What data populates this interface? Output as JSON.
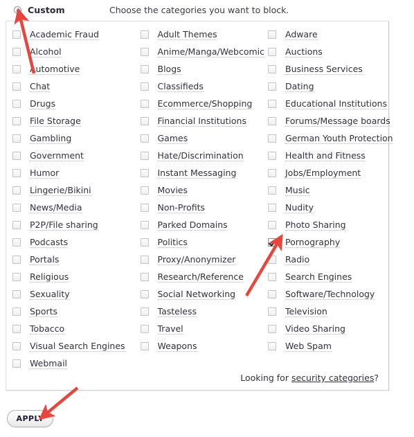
{
  "header": {
    "mode_label": "Custom",
    "instruction": "Choose the categories you want to block.",
    "radio_selected": true
  },
  "colors": {
    "text": "#31313c",
    "border": "#dedede",
    "arrow": "#e8453c",
    "checkbox_border": "#c3c3c3"
  },
  "categories": {
    "column_1": [
      {
        "label": "Academic Fraud",
        "checked": false
      },
      {
        "label": "Alcohol",
        "checked": false
      },
      {
        "label": "Automotive",
        "checked": false
      },
      {
        "label": "Chat",
        "checked": false
      },
      {
        "label": "Drugs",
        "checked": false
      },
      {
        "label": "File Storage",
        "checked": false
      },
      {
        "label": "Gambling",
        "checked": false
      },
      {
        "label": "Government",
        "checked": false
      },
      {
        "label": "Humor",
        "checked": false
      },
      {
        "label": "Lingerie/Bikini",
        "checked": false
      },
      {
        "label": "News/Media",
        "checked": false
      },
      {
        "label": "P2P/File sharing",
        "checked": false
      },
      {
        "label": "Podcasts",
        "checked": false
      },
      {
        "label": "Portals",
        "checked": false
      },
      {
        "label": "Religious",
        "checked": false
      },
      {
        "label": "Sexuality",
        "checked": false
      },
      {
        "label": "Sports",
        "checked": false
      },
      {
        "label": "Tobacco",
        "checked": false
      },
      {
        "label": "Visual Search Engines",
        "checked": false
      },
      {
        "label": "Webmail",
        "checked": false
      }
    ],
    "column_2": [
      {
        "label": "Adult Themes",
        "checked": false
      },
      {
        "label": "Anime/Manga/Webcomic",
        "checked": false
      },
      {
        "label": "Blogs",
        "checked": false
      },
      {
        "label": "Classifieds",
        "checked": false
      },
      {
        "label": "Ecommerce/Shopping",
        "checked": false
      },
      {
        "label": "Financial Institutions",
        "checked": false
      },
      {
        "label": "Games",
        "checked": false
      },
      {
        "label": "Hate/Discrimination",
        "checked": false
      },
      {
        "label": "Instant Messaging",
        "checked": false
      },
      {
        "label": "Movies",
        "checked": false
      },
      {
        "label": "Non-Profits",
        "checked": false
      },
      {
        "label": "Parked Domains",
        "checked": false
      },
      {
        "label": "Politics",
        "checked": false
      },
      {
        "label": "Proxy/Anonymizer",
        "checked": false
      },
      {
        "label": "Research/Reference",
        "checked": false
      },
      {
        "label": "Social Networking",
        "checked": false
      },
      {
        "label": "Tasteless",
        "checked": false
      },
      {
        "label": "Travel",
        "checked": false
      },
      {
        "label": "Weapons",
        "checked": false
      }
    ],
    "column_3": [
      {
        "label": "Adware",
        "checked": false
      },
      {
        "label": "Auctions",
        "checked": false
      },
      {
        "label": "Business Services",
        "checked": false
      },
      {
        "label": "Dating",
        "checked": false
      },
      {
        "label": "Educational Institutions",
        "checked": false
      },
      {
        "label": "Forums/Message boards",
        "checked": false
      },
      {
        "label": "German Youth Protection",
        "checked": false
      },
      {
        "label": "Health and Fitness",
        "checked": false
      },
      {
        "label": "Jobs/Employment",
        "checked": false
      },
      {
        "label": "Music",
        "checked": false
      },
      {
        "label": "Nudity",
        "checked": false
      },
      {
        "label": "Photo Sharing",
        "checked": false
      },
      {
        "label": "Pornography",
        "checked": true
      },
      {
        "label": "Radio",
        "checked": false
      },
      {
        "label": "Search Engines",
        "checked": false
      },
      {
        "label": "Software/Technology",
        "checked": false
      },
      {
        "label": "Television",
        "checked": false
      },
      {
        "label": "Video Sharing",
        "checked": false
      },
      {
        "label": "Web Spam",
        "checked": false
      }
    ]
  },
  "footer": {
    "note_prefix": "Looking for ",
    "note_link": "security categories",
    "note_suffix": "?"
  },
  "actions": {
    "apply_label": "APPLY"
  },
  "annotations": [
    {
      "name": "arrow-to-custom-radio"
    },
    {
      "name": "arrow-to-pornography-checkbox"
    },
    {
      "name": "arrow-to-apply-button"
    }
  ]
}
